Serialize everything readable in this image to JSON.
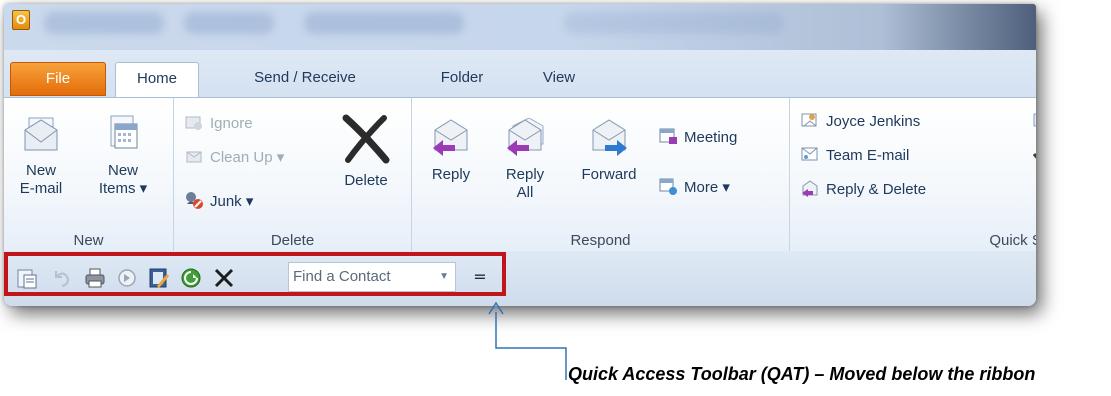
{
  "titlebar": {
    "app_icon_letter": "O"
  },
  "tabs": [
    {
      "label": "File"
    },
    {
      "label": "Home"
    },
    {
      "label": "Send / Receive"
    },
    {
      "label": "Folder"
    },
    {
      "label": "View"
    }
  ],
  "ribbon": {
    "new": {
      "label": "New",
      "new_email": "New\nE-mail",
      "new_email_l1": "New",
      "new_email_l2": "E-mail",
      "new_items_l1": "New",
      "new_items_l2": "Items ▾"
    },
    "delete": {
      "label": "Delete",
      "ignore": "Ignore",
      "clean_up": "Clean Up ▾",
      "junk": "Junk ▾",
      "delete_btn": "Delete"
    },
    "respond": {
      "label": "Respond",
      "reply": "Reply",
      "reply_all_l1": "Reply",
      "reply_all_l2": "All",
      "forward": "Forward",
      "meeting": "Meeting",
      "more": "More ▾"
    },
    "quick_steps": {
      "label": "Quick St",
      "items": [
        "Joyce Jenkins",
        "Team E-mail",
        "Reply & Delete"
      ]
    }
  },
  "qat": {
    "icons": [
      "save-icon",
      "undo-icon",
      "print-icon",
      "next-icon",
      "address-book-icon",
      "send-receive-icon",
      "delete-icon"
    ],
    "find_contact": "Find a Contact",
    "customize_glyph": "="
  },
  "annotation": {
    "text": "Quick Access Toolbar (QAT) – Moved below the ribbon"
  },
  "colors": {
    "file_tab": "#e36d0a",
    "highlight_border": "#c0151b",
    "callout_line": "#2e75b6"
  }
}
